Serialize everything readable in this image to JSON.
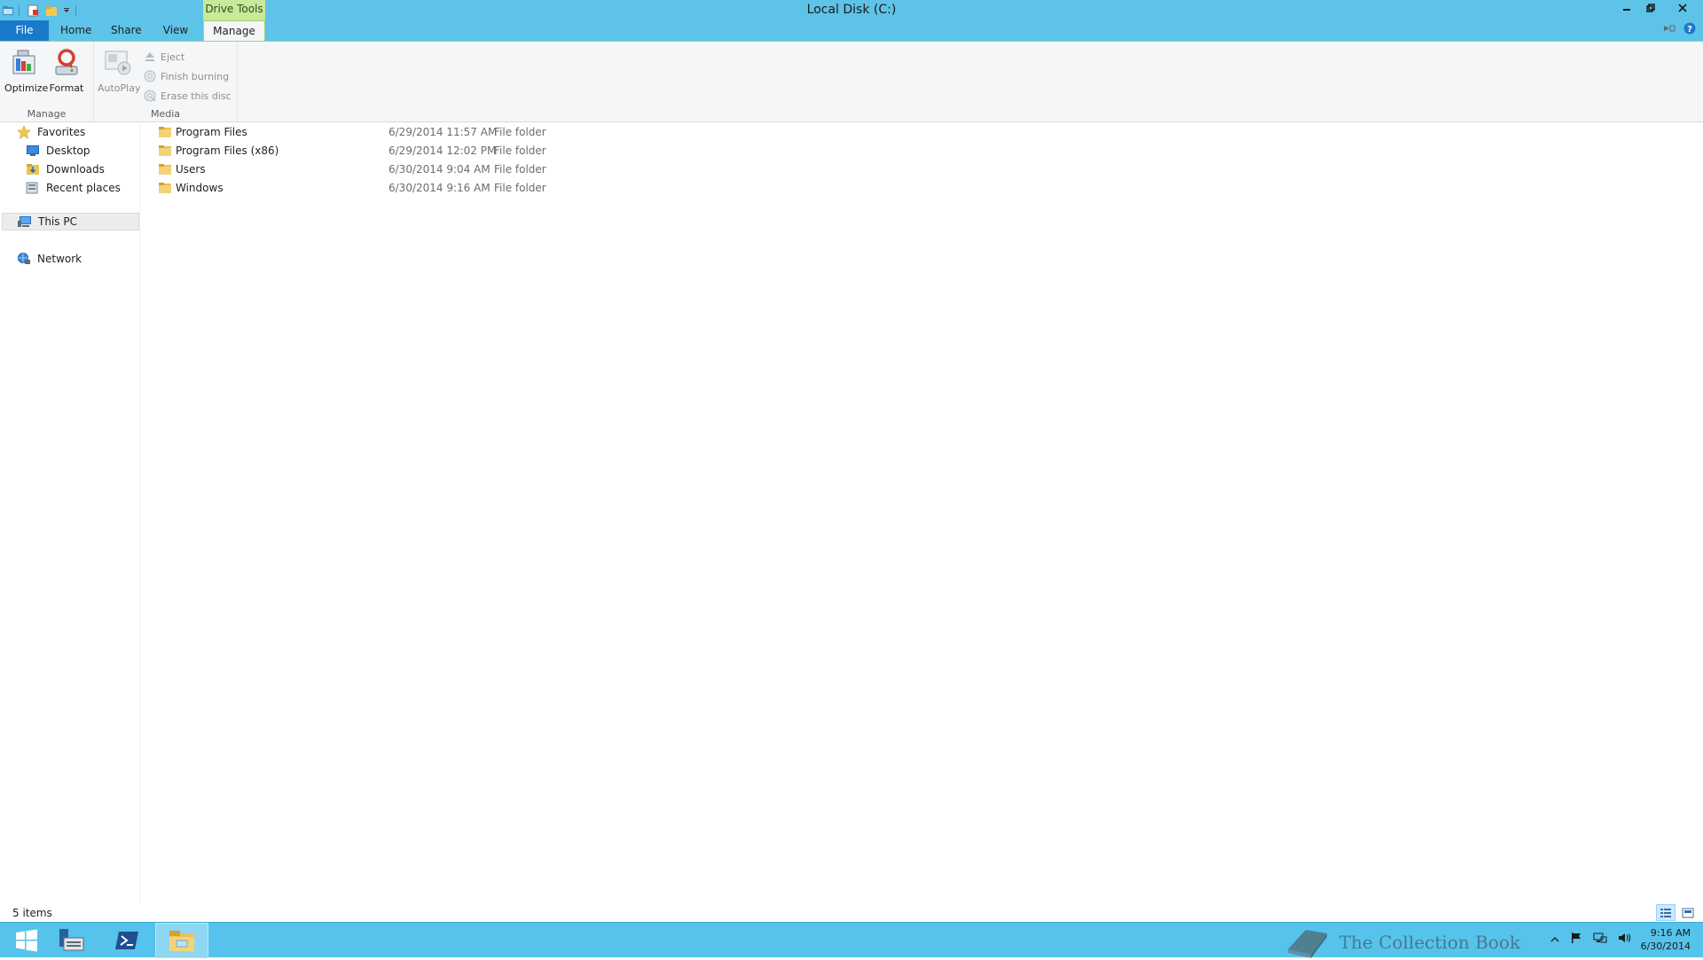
{
  "window": {
    "title": "Local Disk (C:)",
    "context_tab_header": "Drive Tools",
    "controls": {
      "minimize_icon": "minimize-icon",
      "restore_icon": "restore-icon",
      "close_icon": "close-icon"
    }
  },
  "ribbon": {
    "tabs": [
      {
        "label": "File"
      },
      {
        "label": "Home"
      },
      {
        "label": "Share"
      },
      {
        "label": "View"
      },
      {
        "label": "Manage"
      }
    ],
    "groups": {
      "manage": {
        "label": "Manage",
        "optimize_label": "Optimize",
        "format_label": "Format"
      },
      "media": {
        "label": "Media",
        "autoplay_label": "AutoPlay",
        "eject_label": "Eject",
        "finish_burning_label": "Finish burning",
        "erase_disc_label": "Erase this disc"
      }
    }
  },
  "navigation": {
    "favorites": {
      "label": "Favorites",
      "items": [
        {
          "label": "Desktop"
        },
        {
          "label": "Downloads"
        },
        {
          "label": "Recent places"
        }
      ]
    },
    "this_pc": {
      "label": "This PC"
    },
    "network": {
      "label": "Network"
    }
  },
  "files": [
    {
      "name": "Program Files",
      "date": "6/29/2014 11:57 AM",
      "type": "File folder"
    },
    {
      "name": "Program Files (x86)",
      "date": "6/29/2014 12:02 PM",
      "type": "File folder"
    },
    {
      "name": "Users",
      "date": "6/30/2014 9:04 AM",
      "type": "File folder"
    },
    {
      "name": "Windows",
      "date": "6/30/2014 9:16 AM",
      "type": "File folder"
    }
  ],
  "status": {
    "item_count": "5 items"
  },
  "taskbar": {
    "clock_time": "9:16 AM",
    "clock_date": "6/30/2014"
  },
  "watermark": {
    "text": "The Collection Book"
  },
  "colors": {
    "titlebar": "#5ec3e8",
    "file_tab": "#1979ca",
    "context_tab": "#c8e89a",
    "ribbon_bg": "#f5f6f7",
    "taskbar": "#55c3ec",
    "folder_yellow": "#e8c15a"
  }
}
